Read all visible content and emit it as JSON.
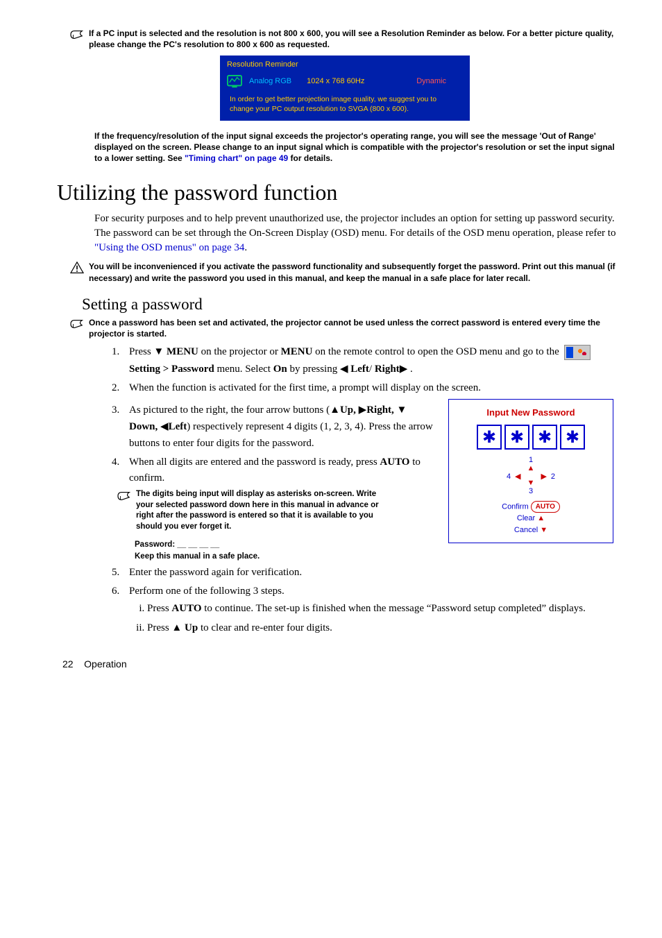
{
  "noteResolution": "If a PC input is selected and the resolution is not 800 x 600, you will see a Resolution Reminder as below. For a better picture quality, please change the PC's resolution to 800 x 600 as requested.",
  "reminder": {
    "title": "Resolution Reminder",
    "label": "Analog RGB",
    "value": "1024 x 768  60Hz",
    "mode": "Dynamic",
    "msg": "In order to get better projection image quality, we suggest you to change your PC output resolution to SVGA (800 x 600)."
  },
  "noteFreqA": "If the frequency/resolution of the input signal exceeds the projector's operating range, you will see the message 'Out of Range' displayed on the screen. Please change to an input signal which is compatible with the projector's resolution or set the input signal to a lower setting. See ",
  "noteFreqLink": "\"Timing chart\" on page 49",
  "noteFreqB": " for details.",
  "h1": "Utilizing the password function",
  "para1a": "For security purposes and to help prevent unauthorized use, the projector includes an option for setting up password security. The password can be set through the On-Screen Display (OSD) menu. For details of the OSD menu operation, please refer to ",
  "para1Link": "\"Using the OSD menus\" on page 34",
  "para1b": ".",
  "warnInconv": "You will be inconvenienced if you activate the password functionality and subsequently forget the password. Print out this manual (if necessary) and write the password you used in this manual, and keep the manual in a safe place for later recall.",
  "h2": "Setting a password",
  "noteOnceSet": "Once a password has been set and activated, the projector cannot be used unless the correct password is entered every time the projector is started.",
  "step1a": "Press ",
  "step1menu": " MENU",
  "step1b": " on the projector or ",
  "step1menu2": "MENU",
  "step1c": " on the remote control to open the OSD menu and go to the ",
  "step1d": "Setting > Password",
  "step1e": " menu. Select ",
  "step1on": "On",
  "step1f": " by pressing ",
  "step1g": "Left",
  "step1h": "Right",
  "step1i": " .",
  "step2": "When the function is activated for the first time, a prompt will display on the screen.",
  "step3a": "As pictured to the right, the four arrow buttons (",
  "step3up": "Up, ",
  "step3right": "Right, ",
  "step3down": " Down, ",
  "step3left": "Left",
  "step3b": ") respectively represent 4 digits (1, 2, 3, 4). Press the arrow buttons to enter four digits for the password.",
  "step4a": "When all digits are entered and the password is ready, press ",
  "step4auto": "AUTO",
  "step4b": " to confirm.",
  "noteDigits": "The digits being input will display as asterisks on-screen. Write your selected password down here in this manual in advance or right after the password is entered so that it is available to you should you ever forget it.",
  "pwLabel": "Password: __ __ __ __",
  "pwKeep": "Keep this manual in a safe place.",
  "step5": "Enter the password again for verification.",
  "step6": "Perform one of the following 3 steps.",
  "step6ia": "Press ",
  "step6iauto": "AUTO",
  "step6ib": " to continue. The set-up is finished when the message “Password setup completed” displays.",
  "step6iia": "Press ",
  "step6iiup": "Up",
  "step6iib": " to clear and re-enter four digits.",
  "panel": {
    "title": "Input New Password",
    "confirm": "Confirm",
    "auto": "AUTO",
    "clear": "Clear",
    "cancel": "Cancel",
    "d1": "1",
    "d2": "2",
    "d3": "3",
    "d4": "4"
  },
  "footerPage": "22",
  "footerSection": "Operation"
}
